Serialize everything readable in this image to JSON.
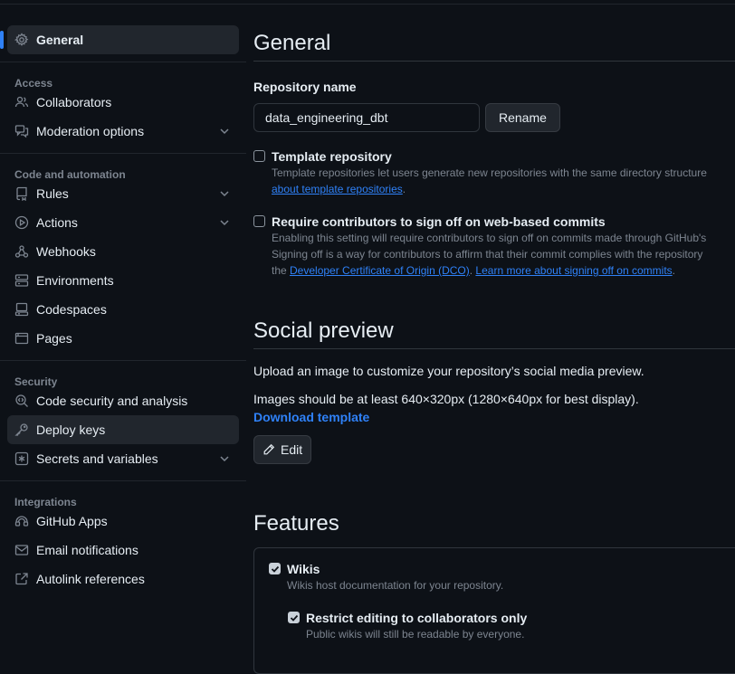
{
  "sidebar": {
    "active": {
      "label": "General",
      "icon": "gear-icon"
    },
    "sections": [
      {
        "title": "Access",
        "items": [
          {
            "label": "Collaborators",
            "icon": "people-icon",
            "chevron": false
          },
          {
            "label": "Moderation options",
            "icon": "comment-discussion-icon",
            "chevron": true
          }
        ]
      },
      {
        "title": "Code and automation",
        "items": [
          {
            "label": "Rules",
            "icon": "repo-push-icon",
            "chevron": true
          },
          {
            "label": "Actions",
            "icon": "play-icon",
            "chevron": true
          },
          {
            "label": "Webhooks",
            "icon": "webhook-icon",
            "chevron": false
          },
          {
            "label": "Environments",
            "icon": "server-icon",
            "chevron": false
          },
          {
            "label": "Codespaces",
            "icon": "codespaces-icon",
            "chevron": false
          },
          {
            "label": "Pages",
            "icon": "browser-icon",
            "chevron": false
          }
        ]
      },
      {
        "title": "Security",
        "items": [
          {
            "label": "Code security and analysis",
            "icon": "codescan-icon",
            "chevron": false
          },
          {
            "label": "Deploy keys",
            "icon": "key-icon",
            "chevron": false,
            "selected": true
          },
          {
            "label": "Secrets and variables",
            "icon": "asterisk-icon",
            "chevron": true
          }
        ]
      },
      {
        "title": "Integrations",
        "items": [
          {
            "label": "GitHub Apps",
            "icon": "apps-icon",
            "chevron": false
          },
          {
            "label": "Email notifications",
            "icon": "mail-icon",
            "chevron": false
          },
          {
            "label": "Autolink references",
            "icon": "cross-reference-icon",
            "chevron": false
          }
        ]
      }
    ]
  },
  "general": {
    "title": "General",
    "repo_name_label": "Repository name",
    "repo_name_value": "data_engineering_dbt",
    "rename_button": "Rename",
    "template": {
      "title": "Template repository",
      "desc_line1": "Template repositories let users generate new repositories with the same directory structure",
      "link": "about template repositories",
      "after_link": "."
    },
    "signoff": {
      "title": "Require contributors to sign off on web-based commits",
      "desc_line1": "Enabling this setting will require contributors to sign off on commits made through GitHub's",
      "desc_line2": "Signing off is a way for contributors to affirm that their commit complies with the repository",
      "desc_line3_prefix": "the ",
      "link1": "Developer Certificate of Origin (DCO)",
      "between": ". ",
      "link2": "Learn more about signing off on commits",
      "suffix": "."
    }
  },
  "social": {
    "title": "Social preview",
    "line1": "Upload an image to customize your repository’s social media preview.",
    "line2": "Images should be at least 640×320px (1280×640px for best display).",
    "download_link": "Download template",
    "edit_button": "Edit"
  },
  "features": {
    "title": "Features",
    "wikis": {
      "title": "Wikis",
      "desc": "Wikis host documentation for your repository.",
      "checked": true
    },
    "restrict": {
      "title": "Restrict editing to collaborators only",
      "desc": "Public wikis will still be readable by everyone.",
      "checked": true
    }
  },
  "colors": {
    "accent": "#2f81f7",
    "background": "#0d1117",
    "border": "#30363d"
  }
}
